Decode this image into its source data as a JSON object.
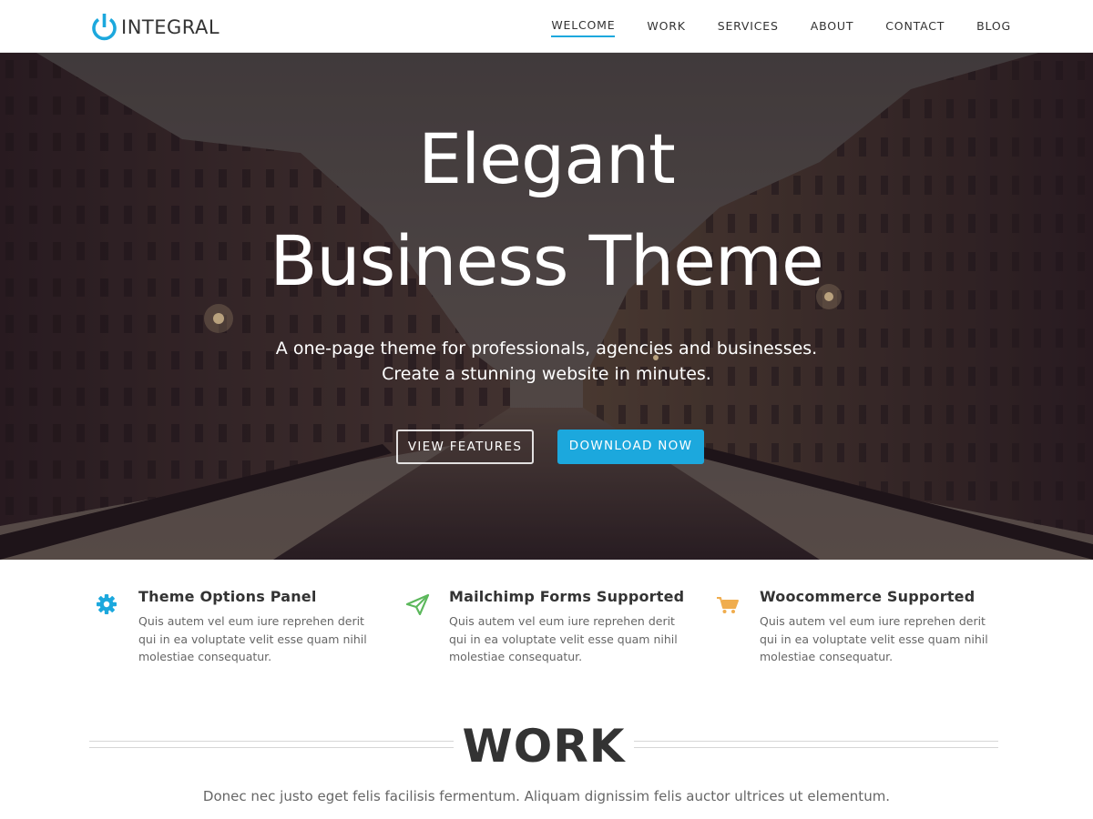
{
  "brand": {
    "name": "INTEGRAL",
    "accent_color": "#1ca8dd",
    "logo_icon": "power-icon"
  },
  "nav": {
    "items": [
      {
        "label": "WELCOME",
        "active": true
      },
      {
        "label": "WORK",
        "active": false
      },
      {
        "label": "SERVICES",
        "active": false
      },
      {
        "label": "ABOUT",
        "active": false
      },
      {
        "label": "CONTACT",
        "active": false
      },
      {
        "label": "BLOG",
        "active": false
      }
    ]
  },
  "hero": {
    "title_line1": "Elegant",
    "title_line2": "Business Theme",
    "subtitle_line1": "A one-page theme for professionals, agencies and businesses.",
    "subtitle_line2": "Create a stunning website in minutes.",
    "button_secondary": "VIEW FEATURES",
    "button_primary": "DOWNLOAD NOW"
  },
  "features": [
    {
      "icon": "gear-icon",
      "icon_color": "#1ca8dd",
      "title": "Theme Options Panel",
      "text": "Quis autem vel eum iure reprehen derit qui in ea voluptate velit esse quam nihil molestiae consequatur."
    },
    {
      "icon": "paper-plane-icon",
      "icon_color": "#5cb85c",
      "title": "Mailchimp Forms Supported",
      "text": "Quis autem vel eum iure reprehen derit qui in ea voluptate velit esse quam nihil molestiae consequatur."
    },
    {
      "icon": "shopping-cart-icon",
      "icon_color": "#f0ad4e",
      "title": "Woocommerce Supported",
      "text": "Quis autem vel eum iure reprehen derit qui in ea voluptate velit esse quam nihil molestiae consequatur."
    }
  ],
  "work": {
    "title": "WORK",
    "subtitle": "Donec nec justo eget felis facilisis fermentum. Aliquam dignissim felis auctor ultrices ut elementum."
  }
}
